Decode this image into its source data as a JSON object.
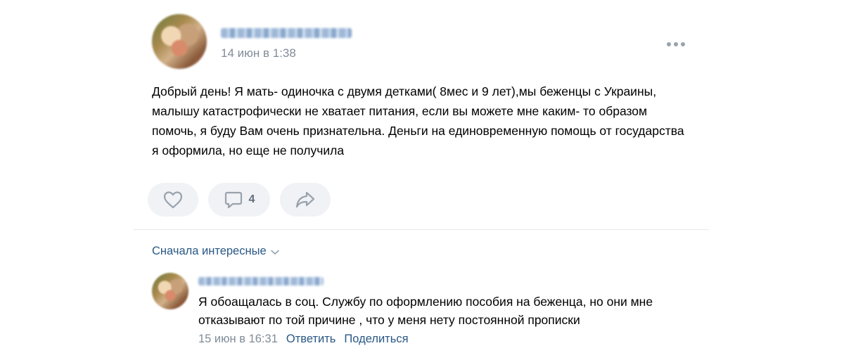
{
  "post": {
    "date": "14 июн в 1:38",
    "text": "Добрый день! Я мать- одиночка с двумя детками( 8мес и 9 лет),мы беженцы с Украины, малышу катастрофически не хватает питания, если вы можете мне каким- то образом помочь, я буду Вам очень признательна. Деньги на единовременную помощь от государства я оформила, но еще не получила",
    "actions": {
      "like_icon": "heart-icon",
      "comment_icon": "comment-icon",
      "comment_count": "4",
      "share_icon": "share-icon"
    }
  },
  "comments": {
    "sort_label": "Сначала интересные",
    "items": [
      {
        "text": "Я обоащалась в соц. Службу по оформлению пособия на беженца, но они мне отказывают по той причине , что у меня нету постоянной прописки",
        "date": "15 июн в 16:31",
        "reply_label": "Ответить",
        "share_label": "Поделиться"
      }
    ]
  },
  "colors": {
    "link": "#2a5885",
    "secondary_text": "#818c99",
    "action_bg": "#f0f2f5",
    "icon": "#99a2ad"
  }
}
